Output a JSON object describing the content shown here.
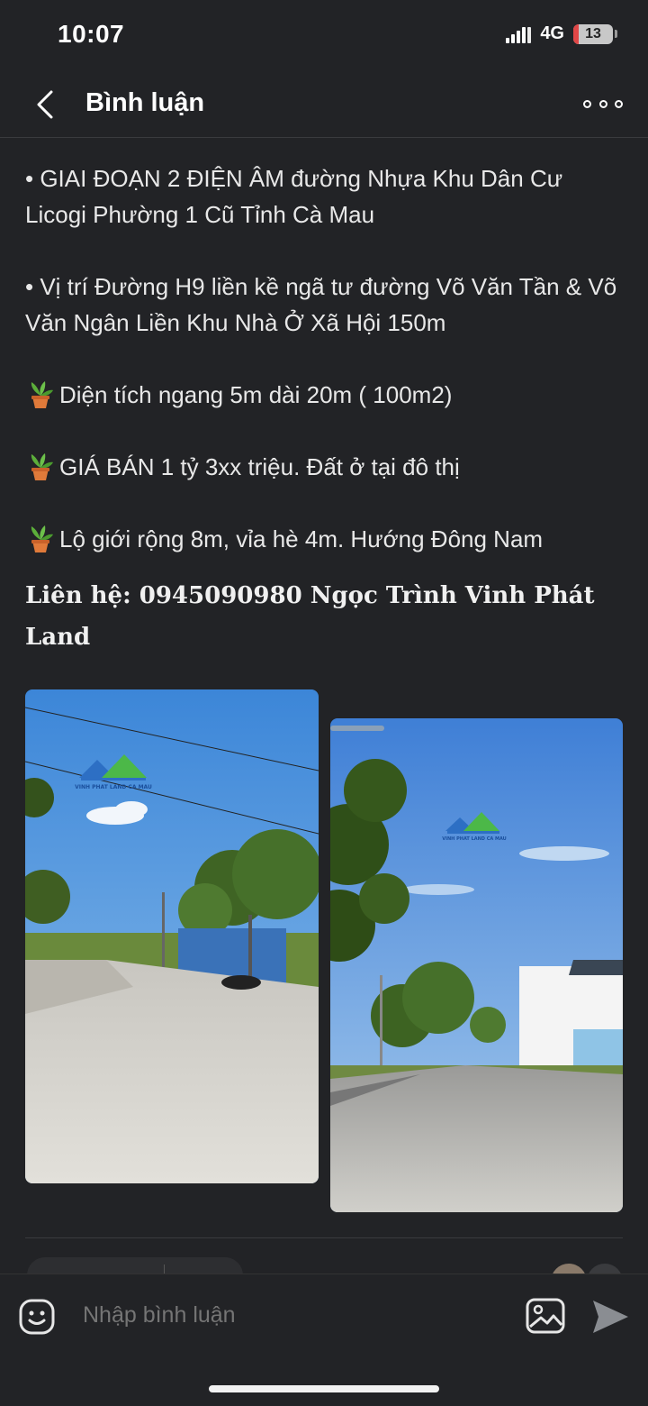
{
  "status_bar": {
    "time": "10:07",
    "network": "4G",
    "battery": "13",
    "battery_level_percent": 13
  },
  "header": {
    "title": "Bình luận",
    "back_icon": "chevron-left-icon",
    "more_icon": "more-horizontal-icon"
  },
  "post": {
    "paragraphs": [
      "• GIAI ĐOẠN 2 ĐIỆN ÂM đường Nhựa Khu Dân Cư Licogi Phường 1 Cũ Tỉnh Cà Mau",
      "• Vị trí Đường H9 liền kề ngã tư đường Võ Văn Tần & Võ Văn Ngân Liền  Khu Nhà Ở Xã Hội 150m"
    ],
    "features": [
      "Diện tích ngang 5m dài 20m ( 100m2)",
      "GIÁ BÁN 1 tỷ 3xx triệu. Đất ở tại đô thị",
      "Lộ giới rộng 8m, vỉa hè 4m. Hướng Đông Nam"
    ],
    "feature_icon": "potted-plant-emoji",
    "contact": "Liên hệ: 0945090980 Ngọc Trình Vinh Phát Land",
    "photo_watermark": "VINH PHAT LAND CA MAU"
  },
  "comment_bar": {
    "placeholder": "Nhập bình luận",
    "emoji_icon": "smiley-icon",
    "image_icon": "image-icon",
    "send_icon": "send-icon"
  },
  "colors": {
    "background": "#222326",
    "text": "#ececec",
    "placeholder": "#a8a8a8",
    "battery_low": "#e04646"
  }
}
